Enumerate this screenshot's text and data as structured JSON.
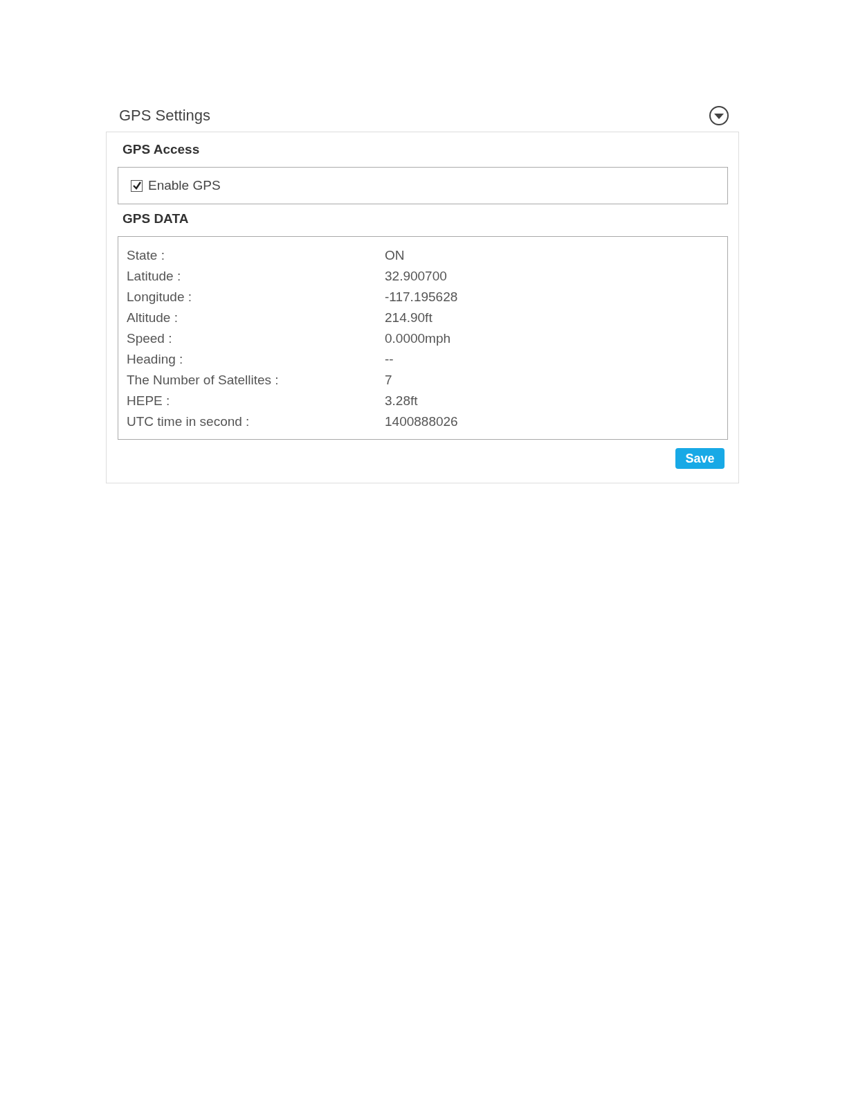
{
  "title": "GPS Settings",
  "access": {
    "heading": "GPS Access",
    "enable": {
      "label": "Enable GPS",
      "checked": true
    }
  },
  "data": {
    "heading": "GPS DATA",
    "rows": [
      {
        "label": "State :",
        "value": "ON"
      },
      {
        "label": "Latitude :",
        "value": "32.900700"
      },
      {
        "label": "Longitude :",
        "value": "-117.195628"
      },
      {
        "label": "Altitude :",
        "value": "214.90ft"
      },
      {
        "label": "Speed :",
        "value": "0.0000mph"
      },
      {
        "label": "Heading :",
        "value": "--"
      },
      {
        "label": "The Number of Satellites :",
        "value": "7"
      },
      {
        "label": "HEPE :",
        "value": "3.28ft"
      },
      {
        "label": "UTC time in second :",
        "value": "1400888026"
      }
    ]
  },
  "save": "Save"
}
